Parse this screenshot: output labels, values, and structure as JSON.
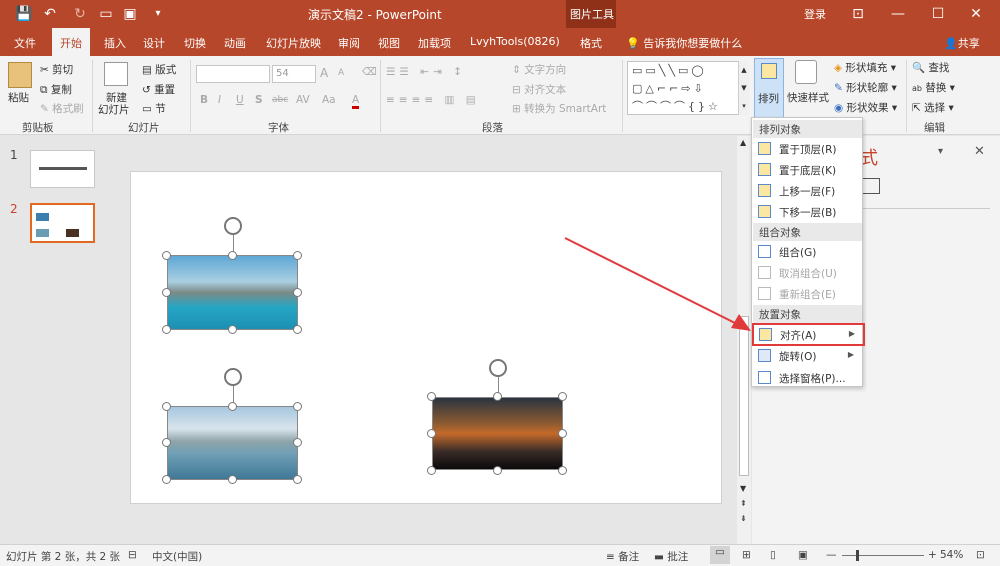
{
  "titlebar": {
    "title": "演示文稿2 - PowerPoint",
    "context_tools": "图片工具",
    "login": "登录"
  },
  "tabs": [
    "文件",
    "开始",
    "插入",
    "设计",
    "切换",
    "动画",
    "幻灯片放映",
    "审阅",
    "视图",
    "加载项",
    "LvyhTools(0826)",
    "格式"
  ],
  "tell_me": "告诉我你想要做什么",
  "share": "共享",
  "ribbon": {
    "clipboard": {
      "label": "剪贴板",
      "paste": "粘贴",
      "cut": "剪切",
      "copy": "复制",
      "format_painter": "格式刷"
    },
    "slides": {
      "label": "幻灯片",
      "new_slide": "新建",
      "new_slide2": "幻灯片",
      "layout": "版式",
      "reset": "重置",
      "section": "节"
    },
    "font": {
      "label": "字体",
      "size": "54",
      "bold": "B",
      "italic": "I",
      "underline": "U",
      "shadow": "S",
      "strike": "abc",
      "font_color": "A",
      "grow": "A",
      "shrink": "A"
    },
    "paragraph": {
      "label": "段落",
      "text_dir": "文字方向",
      "align_text": "对齐文本",
      "smartart": "转换为 SmartArt"
    },
    "drawing": {
      "arrange": "排列",
      "quick_styles": "快速样式",
      "fill": "形状填充",
      "outline": "形状轮廓",
      "effects": "形状效果"
    },
    "editing": {
      "label": "编辑",
      "find": "查找",
      "replace": "替换",
      "select": "选择"
    }
  },
  "slides": [
    {
      "num": "1"
    },
    {
      "num": "2"
    }
  ],
  "menu": {
    "h1": "排列对象",
    "bring_front": "置于顶层(R)",
    "send_back": "置于底层(K)",
    "forward": "上移一层(F)",
    "backward": "下移一层(B)",
    "h2": "组合对象",
    "group": "组合(G)",
    "ungroup": "取消组合(U)",
    "regroup": "重新组合(E)",
    "h3": "放置对象",
    "align": "对齐(A)",
    "rotate": "旋转(O)",
    "selection_pane": "选择窗格(P)..."
  },
  "status": {
    "slide_info": "幻灯片 第 2 张，共 2 张",
    "lang": "中文(中国)",
    "notes": "备注",
    "comments": "批注",
    "zoom": "54%"
  },
  "colors": {
    "accent": "#b7472a",
    "highlight": "#e03a3a"
  }
}
